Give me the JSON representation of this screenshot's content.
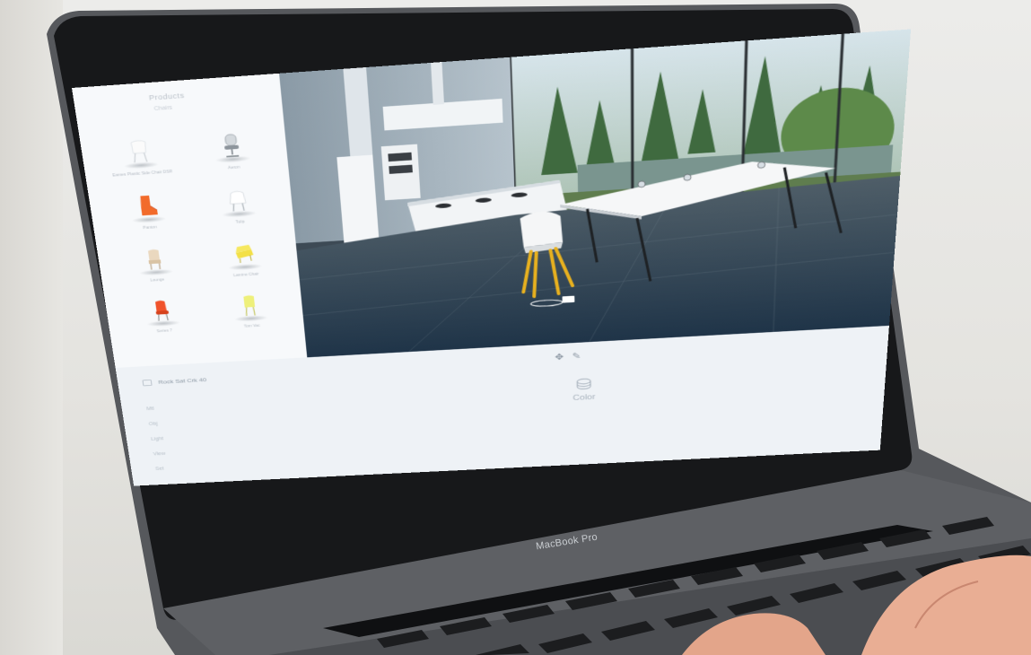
{
  "device": {
    "brand_label": "MacBook Pro"
  },
  "sidebar": {
    "title": "Products",
    "subtitle": "Chairs",
    "items": [
      {
        "label": "Eames Plastic Side Chair DSR",
        "color": "#f4f4f4",
        "icon": "white-chair"
      },
      {
        "label": "Aeron",
        "color": "#dfe3e6",
        "icon": "office-chair"
      },
      {
        "label": "Panton",
        "color": "#f26b2b",
        "icon": "orange-chair"
      },
      {
        "label": "Tulip",
        "color": "#ffffff",
        "icon": "white-armchair"
      },
      {
        "label": "Lounge",
        "color": "#e7d3b8",
        "icon": "beige-chair"
      },
      {
        "label": "Lamino Chair",
        "color": "#f3e046",
        "icon": "yellow-chair"
      },
      {
        "label": "Series 7",
        "color": "#f0532b",
        "icon": "red-chair"
      },
      {
        "label": "Tom Vac",
        "color": "#eef07a",
        "icon": "lime-chair"
      }
    ]
  },
  "viewport": {
    "scene": "kitchen-3d-scene",
    "move_tool_icon": "move-icon",
    "edit_tool_icon": "pencil-icon"
  },
  "tools": {
    "color_label": "Color",
    "color_icon": "paint-bucket-icon"
  },
  "bottom_panel": {
    "title": "Rock Sat Crk 40",
    "tools": [
      "Mtl",
      "Obj",
      "Light",
      "View",
      "Set"
    ]
  },
  "colors": {
    "screen_bg": "#eef2f6",
    "sidebar_bg": "#f7f9fb",
    "chair_leg": "#e8b11f",
    "bezel": "#18191b"
  }
}
